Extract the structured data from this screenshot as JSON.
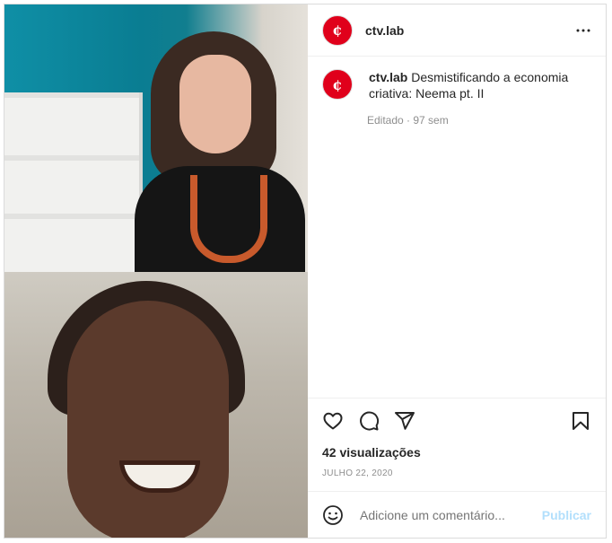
{
  "media": {
    "alt": "Live video with two participants"
  },
  "header": {
    "username": "ctv.lab",
    "avatar_glyph": "¢",
    "more_icon": "more-horizontal-icon"
  },
  "caption": {
    "username": "ctv.lab",
    "text": "Desmistificando a economia criativa: Neema pt. II",
    "meta": "Editado · 97 sem"
  },
  "actions": {
    "like_icon": "heart-icon",
    "comment_icon": "comment-icon",
    "share_icon": "share-icon",
    "save_icon": "bookmark-icon",
    "views": "42 visualizações",
    "date": "JULHO 22, 2020"
  },
  "comment": {
    "emoji_icon": "smiley-icon",
    "placeholder": "Adicione um comentário...",
    "publish_label": "Publicar"
  },
  "colors": {
    "brand": "#e0001b",
    "publish_disabled": "#b2dffc",
    "muted_text": "#8e8e8e"
  }
}
